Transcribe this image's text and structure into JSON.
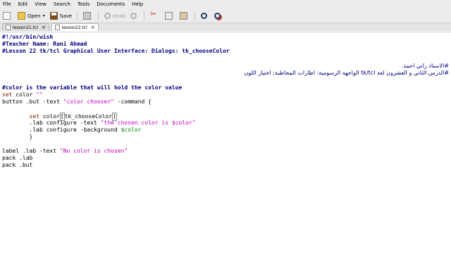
{
  "menubar": {
    "items": [
      {
        "label": "File"
      },
      {
        "label": "Edit"
      },
      {
        "label": "View"
      },
      {
        "label": "Search"
      },
      {
        "label": "Tools"
      },
      {
        "label": "Documents"
      },
      {
        "label": "Help"
      }
    ]
  },
  "toolbar": {
    "open_label": "Open",
    "save_label": "Save",
    "undo_label": "Undo",
    "redo_label": "Redo"
  },
  "tabs": [
    {
      "label": "lesson21.tcl",
      "active": false
    },
    {
      "label": "lesson22.tcl",
      "active": true
    }
  ],
  "editor": {
    "line1": "#!/usr/bin/wish",
    "line2": "#Teacher Name: Rani Ahmad",
    "line3": "#Lesson 22 tk/tcl Graphical User Interface: Dialogs: tk_chooseColor",
    "rtl1": "#الاستاذ راني احمد.",
    "rtl2": "#الدرس الثاني و العشرون لغة tk/tcl الواجهة الرسومية: اطارات المخاطبة: اختيار اللون",
    "comment_color": "#color is the variable that will hold the color value",
    "set_kw": "set",
    "set_rest": " color ",
    "set_str": "\"\"",
    "button_rest": "button .but -text ",
    "button_str": "\"color chooser\"",
    "button_tail": " -command {",
    "indent_set_kw": "        set",
    "indent_set_rest": " color",
    "indent_set_cmd": "tk_chooseColor",
    "lab1_rest": "        .lab configure -text ",
    "lab1_str": "\"the chosen color is $color\"",
    "lab2_rest": "        .lab configure -background ",
    "lab2_var": "$color",
    "close_brace": "        }",
    "label_rest": "label .lab -text ",
    "label_str": "\"No color is chosen\"",
    "pack1": "pack .lab",
    "pack2": "pack .but"
  }
}
